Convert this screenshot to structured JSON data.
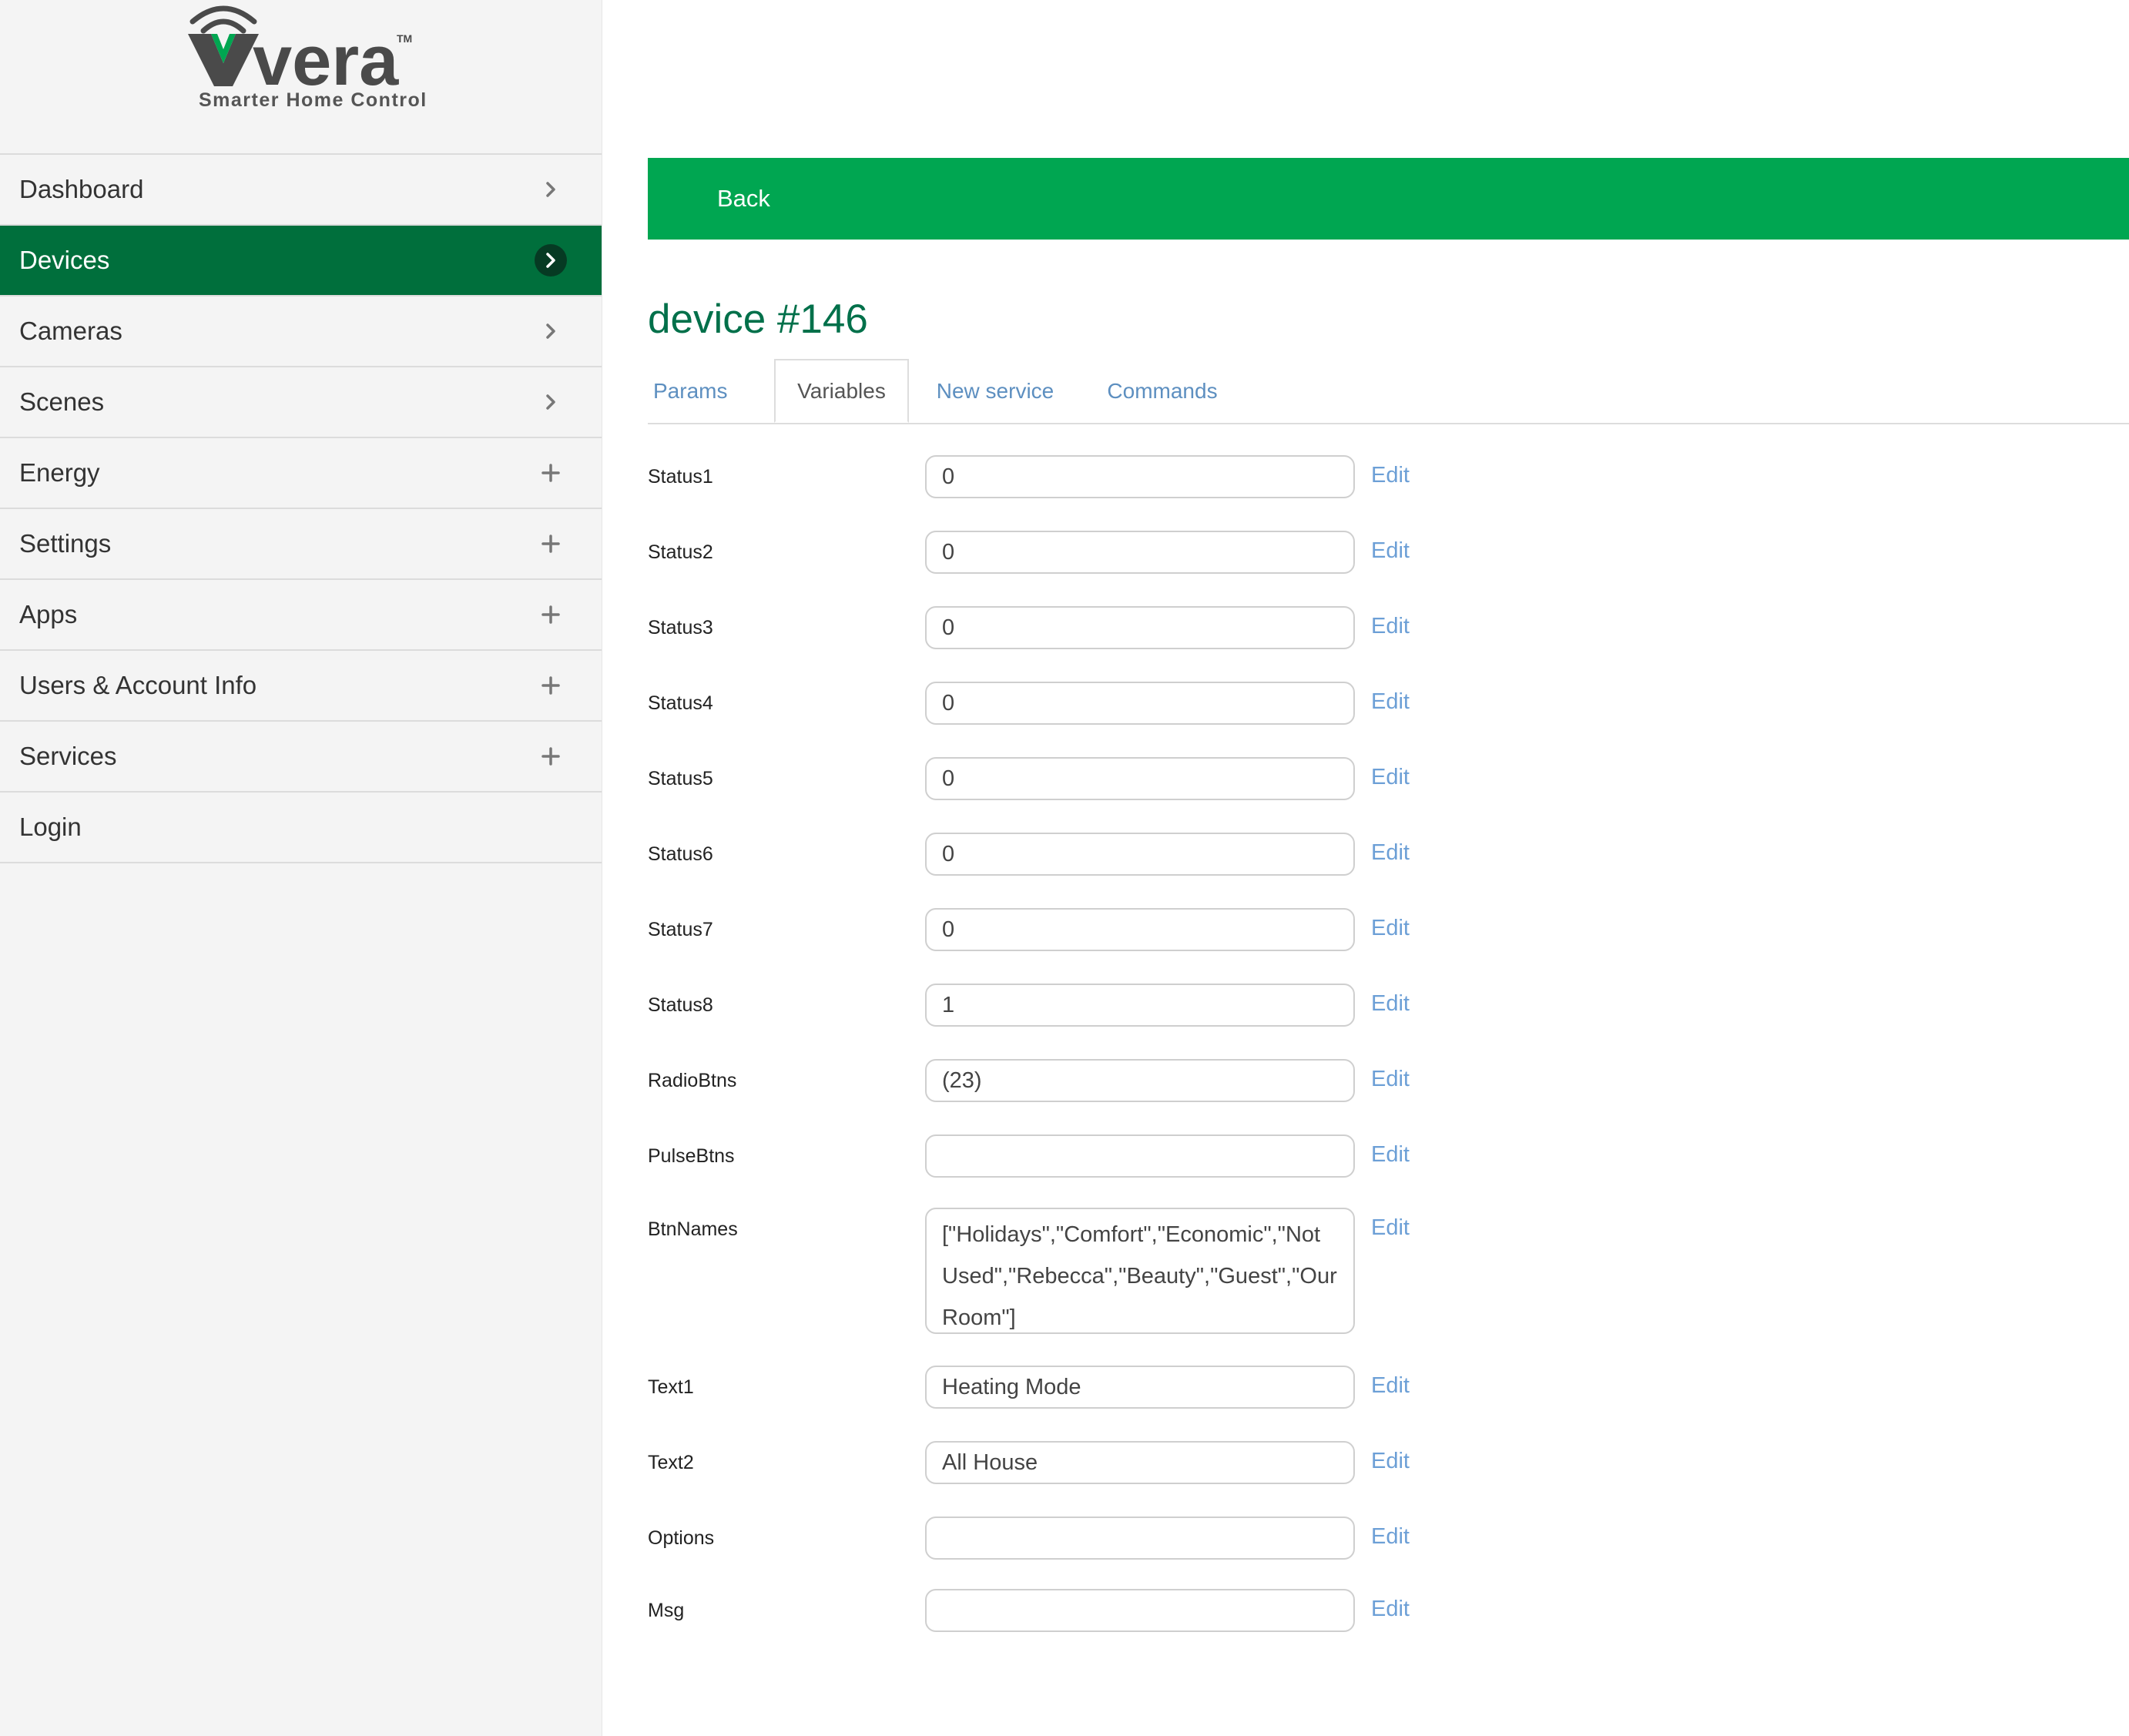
{
  "brand": {
    "logo_text": "vera",
    "trademark": "TM",
    "tagline": "Smarter Home Control"
  },
  "colors": {
    "sidebar_active": "#006f3c",
    "back_bar": "#00a651",
    "title": "#00704a",
    "link": "#6c9fd6"
  },
  "sidebar": {
    "items": [
      {
        "label": "Dashboard",
        "icon": "chevron-right-icon"
      },
      {
        "label": "Devices",
        "icon": "chevron-right-icon",
        "active": true
      },
      {
        "label": "Cameras",
        "icon": "chevron-right-icon"
      },
      {
        "label": "Scenes",
        "icon": "chevron-right-icon"
      },
      {
        "label": "Energy",
        "icon": "plus-icon"
      },
      {
        "label": "Settings",
        "icon": "plus-icon"
      },
      {
        "label": "Apps",
        "icon": "plus-icon"
      },
      {
        "label": "Users & Account Info",
        "icon": "plus-icon"
      },
      {
        "label": "Services",
        "icon": "plus-icon"
      },
      {
        "label": "Login",
        "icon": ""
      }
    ]
  },
  "main": {
    "back_label": "Back",
    "title": "device #146",
    "tabs": [
      {
        "label": "Params"
      },
      {
        "label": "Variables",
        "active": true
      },
      {
        "label": "New service"
      },
      {
        "label": "Commands"
      }
    ],
    "edit_label": "Edit",
    "variables": [
      {
        "name": "Status1",
        "value": "0"
      },
      {
        "name": "Status2",
        "value": "0"
      },
      {
        "name": "Status3",
        "value": "0"
      },
      {
        "name": "Status4",
        "value": "0"
      },
      {
        "name": "Status5",
        "value": "0"
      },
      {
        "name": "Status6",
        "value": "0"
      },
      {
        "name": "Status7",
        "value": "0"
      },
      {
        "name": "Status8",
        "value": "1"
      },
      {
        "name": "RadioBtns",
        "value": "(23)"
      },
      {
        "name": "PulseBtns",
        "value": ""
      },
      {
        "name": "BtnNames",
        "value": "[\"Holidays\",\"Comfort\",\"Economic\",\"Not Used\",\"Rebecca\",\"Beauty\",\"Guest\",\"Our Room\"]"
      },
      {
        "name": "Text1",
        "value": "Heating Mode"
      },
      {
        "name": "Text2",
        "value": "All House"
      },
      {
        "name": "Options",
        "value": ""
      },
      {
        "name": "Msg",
        "value": ""
      }
    ]
  }
}
